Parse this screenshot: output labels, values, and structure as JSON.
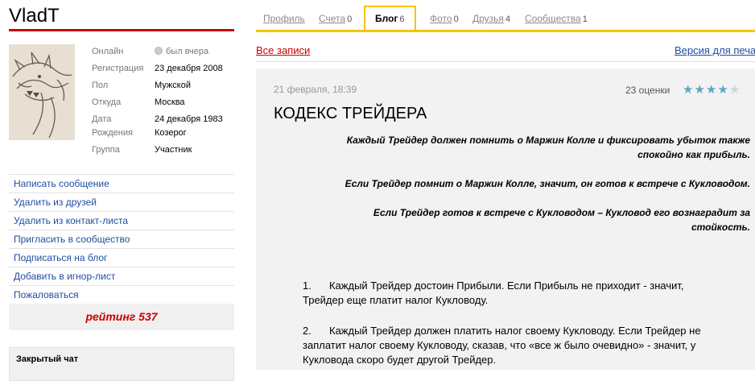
{
  "profile": {
    "username": "VladT",
    "info": [
      {
        "label": "Онлайн",
        "value": "был вчера"
      },
      {
        "label": "Регистрация",
        "value": "23 декабря 2008"
      },
      {
        "label": "Пол",
        "value": "Мужской"
      },
      {
        "label": "Откуда",
        "value": "Москва"
      },
      {
        "label": "Дата",
        "value": "24 декабря 1983"
      },
      {
        "label": "Рождения",
        "value": "Козерог"
      },
      {
        "label": "Группа",
        "value": "Участник"
      }
    ]
  },
  "actions": [
    "Написать сообщение",
    "Удалить из друзей",
    "Удалить из контакт-листа",
    "Пригласить в сообщество",
    "Подписаться на блог",
    "Добавить в игнор-лист",
    "Пожаловаться"
  ],
  "rating": "рейтинг 537",
  "chat": {
    "title": "Закрытый чат"
  },
  "tabs": [
    {
      "label": "Профиль",
      "count": ""
    },
    {
      "label": "Счета",
      "count": "0"
    },
    {
      "label": "Блог",
      "count": "6"
    },
    {
      "label": "Фото",
      "count": "0"
    },
    {
      "label": "Друзья",
      "count": "4"
    },
    {
      "label": "Сообщества",
      "count": "1"
    }
  ],
  "active_tab": "Блог",
  "links": {
    "all_posts": "Все записи",
    "print_version": "Версия для печа"
  },
  "post": {
    "date": "21 февраля, 18:39",
    "ratings": "23 оценки",
    "stars": 4,
    "stars_total": 5,
    "title": "КОДЕКС ТРЕЙДЕРА",
    "quotes": [
      {
        "line1": "Каждый Трейдер должен помнить о Маржин Колле и фиксировать убыток также",
        "line2": "спокойно как прибыль."
      },
      {
        "line1": "Если Трейдер помнит о Маржин Колле, значит, он готов к встрече с Кукловодом.",
        "line2": ""
      },
      {
        "line1": "Если Трейдер готов к встрече с Кукловодом – Кукловод его вознаградит за",
        "line2": "стойкость."
      }
    ],
    "list": [
      {
        "num": "1.",
        "line1": "Каждый Трейдер достоин Прибыли. Если Прибыль не приходит - значит,",
        "line2": "Трейдер еще платит налог Кукловоду.",
        "line3": ""
      },
      {
        "num": "2.",
        "line1": "Каждый Трейдер должен платить налог своему Кукловоду. Если Трейдер не",
        "line2": "заплатит налог своему Кукловоду, сказав, что «все ж было очевидно» - значит, у",
        "line3": "Кукловода скоро будет другой Трейдер."
      }
    ]
  },
  "colors": {
    "accent_red": "#cc0000",
    "tab_yellow": "#f5c400",
    "link_blue": "#1f4ea0",
    "star": "#5aa7c6"
  }
}
